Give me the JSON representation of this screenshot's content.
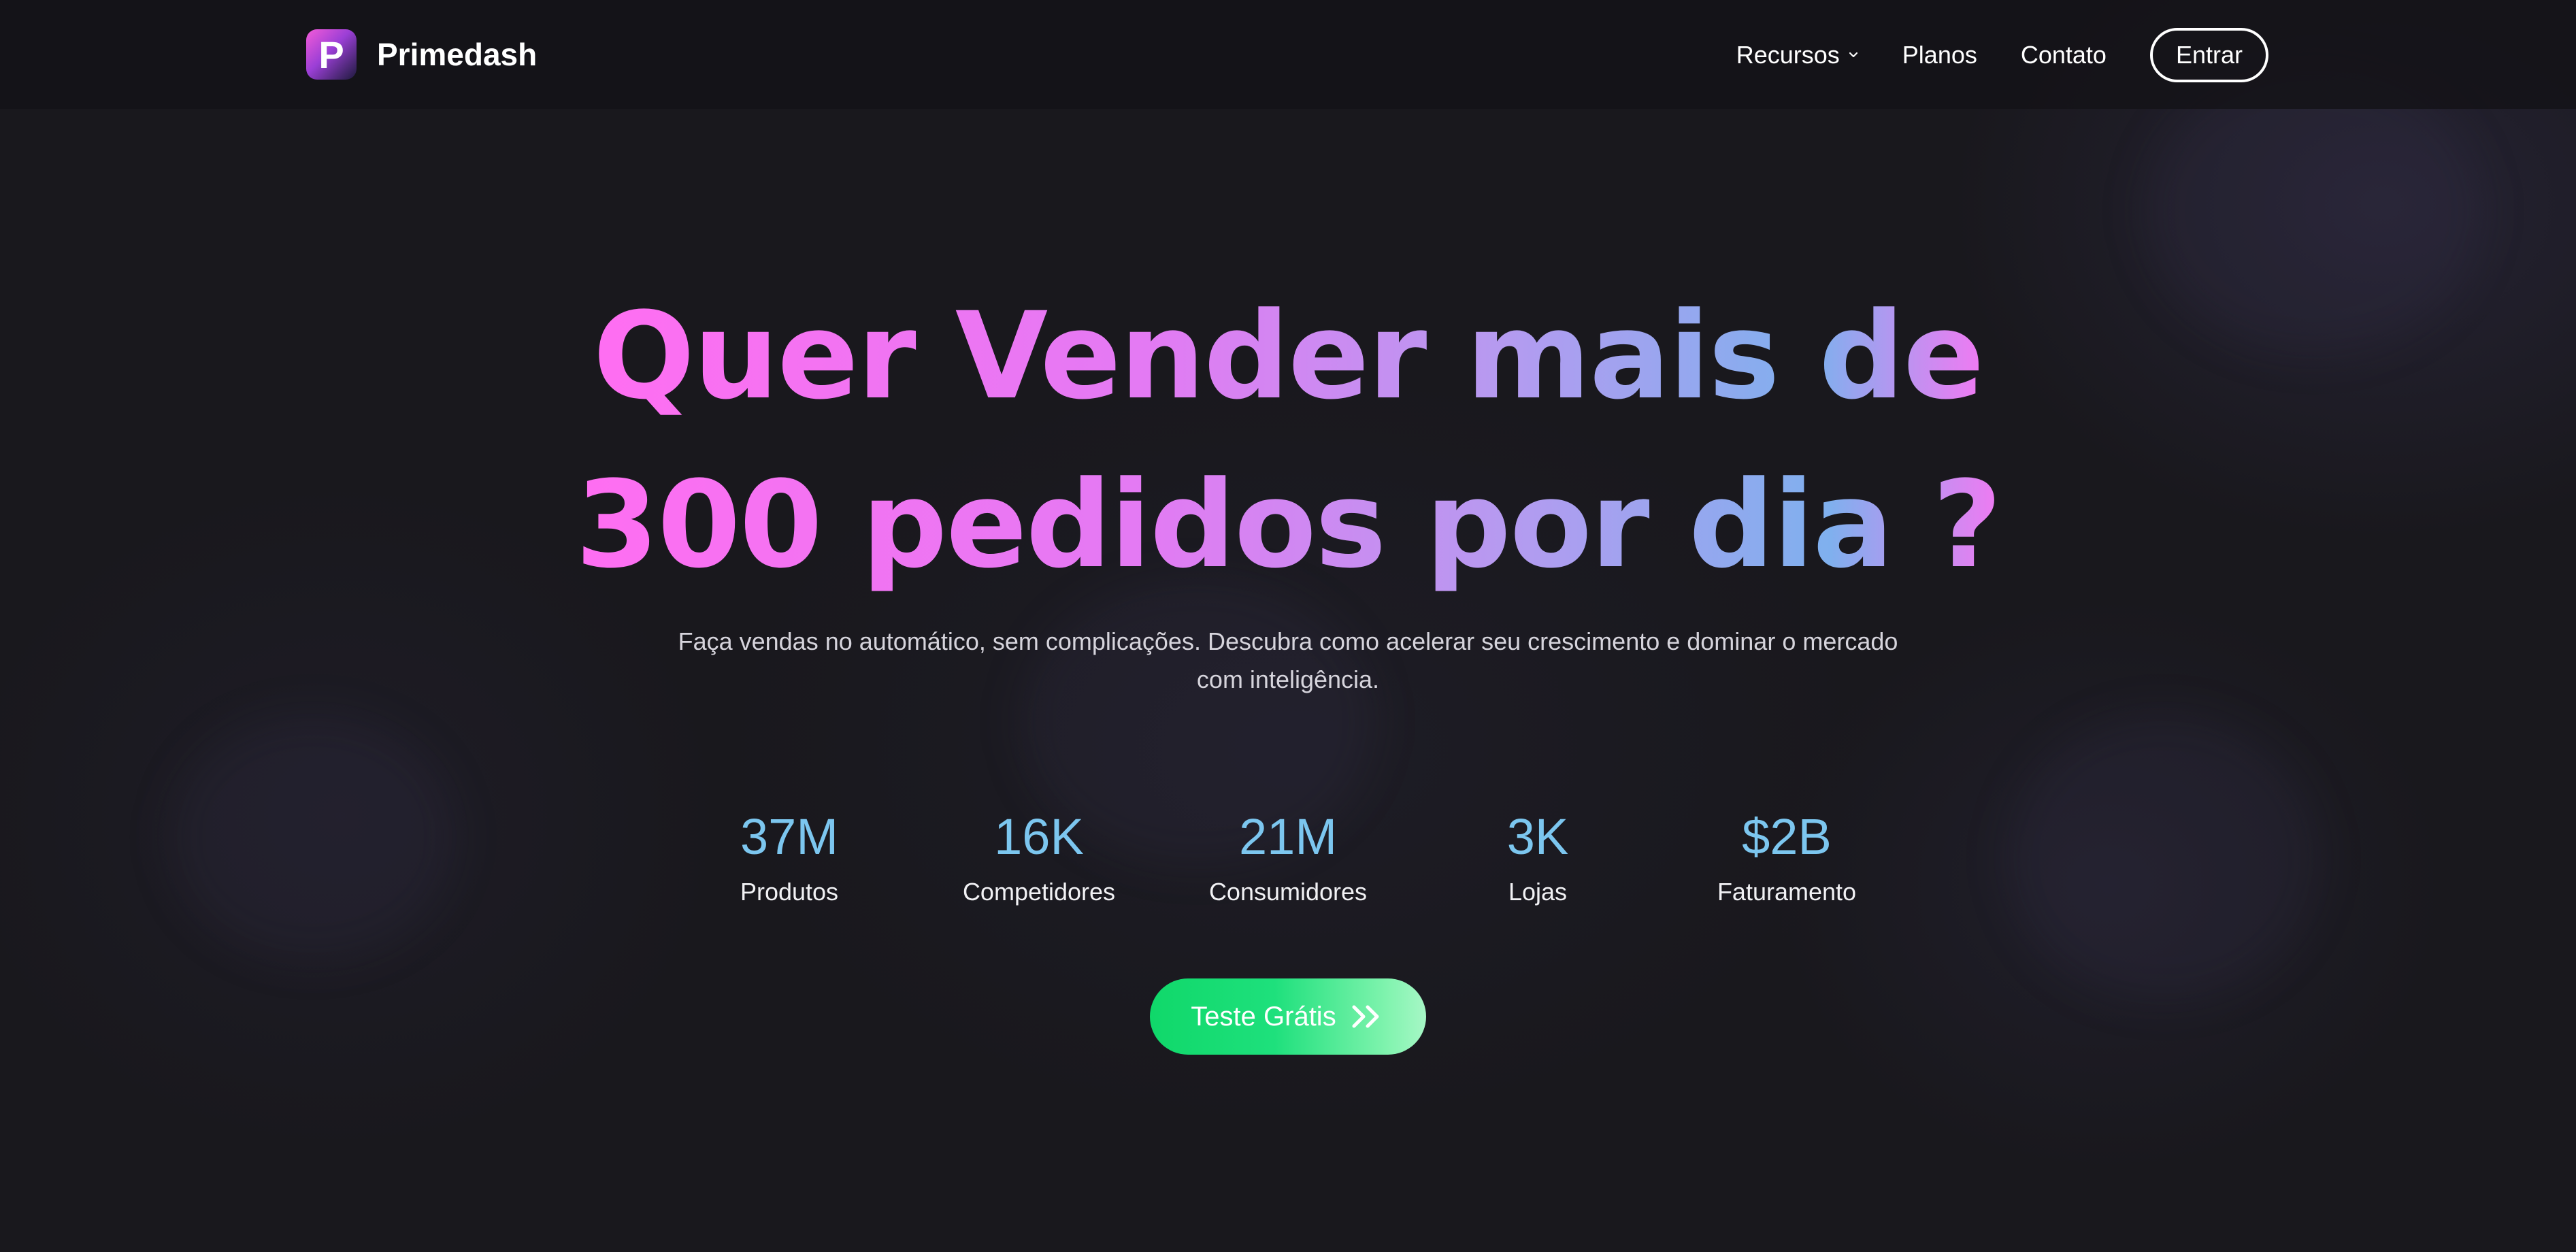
{
  "brand": {
    "logo_letter": "P",
    "name": "Primedash"
  },
  "nav": {
    "items": [
      {
        "label": "Recursos",
        "has_dropdown": true
      },
      {
        "label": "Planos"
      },
      {
        "label": "Contato"
      }
    ],
    "login_label": "Entrar"
  },
  "hero": {
    "headline_line1": "Quer Vender mais de",
    "headline_line2": "300 pedidos por dia ?",
    "subtitle": "Faça vendas no automático, sem complicações. Descubra como acelerar seu crescimento e dominar o mercado com inteligência."
  },
  "stats": [
    {
      "value": "37M",
      "label": "Produtos"
    },
    {
      "value": "16K",
      "label": "Competidores"
    },
    {
      "value": "21M",
      "label": "Consumidores"
    },
    {
      "value": "3K",
      "label": "Lojas"
    },
    {
      "value": "$2B",
      "label": "Faturamento"
    }
  ],
  "cta": {
    "label": "Teste Grátis",
    "icon": "double-chevron-right-icon"
  },
  "colors": {
    "background": "#19181d",
    "stat_value": "#7cc6ef",
    "headline_gradient_start": "#ff6ef2",
    "headline_gradient_end": "#7fb0ee",
    "cta_green": "#10d86a"
  }
}
